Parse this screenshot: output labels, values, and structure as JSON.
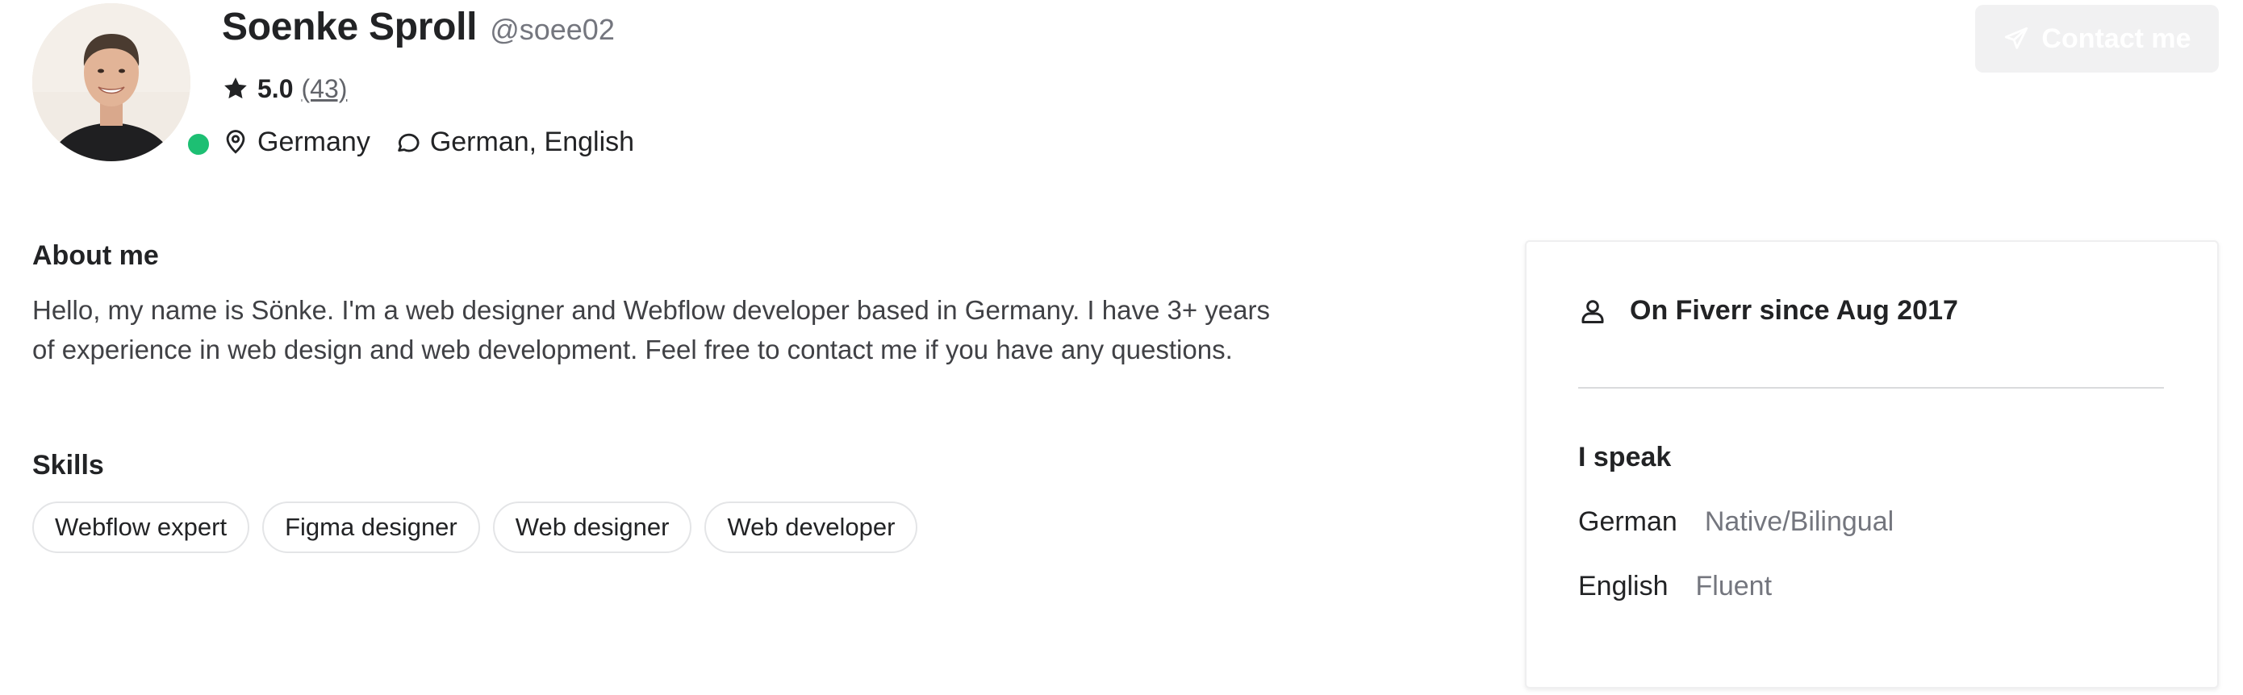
{
  "profile": {
    "display_name": "Soenke Sproll",
    "username": "@soee02",
    "rating": "5.0",
    "rating_count": "(43)",
    "location": "Germany",
    "languages_summary": "German, English",
    "online": true,
    "contact_label": "Contact me"
  },
  "icons": {
    "rating": "star-icon",
    "location": "location-pin-icon",
    "languages": "chat-bubble-icon",
    "contact": "paper-plane-icon",
    "member_since": "user-icon"
  },
  "about": {
    "title": "About me",
    "text": "Hello, my name is Sönke. I'm a web designer and Webflow developer based in Germany. I have 3+ years of experience in web design and web development. Feel free to contact me if you have any questions."
  },
  "skills": {
    "title": "Skills",
    "items": [
      "Webflow expert",
      "Figma designer",
      "Web designer",
      "Web developer"
    ]
  },
  "side_card": {
    "member_since": "On Fiverr since Aug 2017",
    "speak_title": "I speak",
    "languages": [
      {
        "name": "German",
        "level": "Native/Bilingual"
      },
      {
        "name": "English",
        "level": "Fluent"
      }
    ]
  },
  "colors": {
    "online_green": "#1dbf73",
    "text_primary": "#222325",
    "text_secondary": "#74767e",
    "button_disabled_bg": "#f1f1f2"
  }
}
